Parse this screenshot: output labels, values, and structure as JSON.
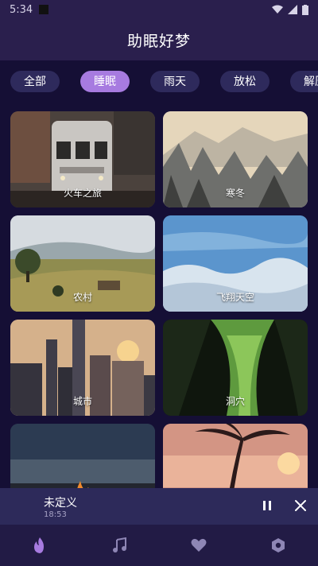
{
  "status_bar": {
    "time": "5:34"
  },
  "header": {
    "title": "助眠好梦"
  },
  "tabs": [
    {
      "label": "全部",
      "active": false
    },
    {
      "label": "睡眠",
      "active": true
    },
    {
      "label": "雨天",
      "active": false
    },
    {
      "label": "放松",
      "active": false
    },
    {
      "label": "解压",
      "active": false
    }
  ],
  "cards": [
    {
      "label": "火车之旅"
    },
    {
      "label": "寒冬"
    },
    {
      "label": "农村"
    },
    {
      "label": "飞翔天空"
    },
    {
      "label": "城市"
    },
    {
      "label": "洞穴"
    },
    {
      "label": ""
    },
    {
      "label": ""
    }
  ],
  "player": {
    "title": "未定义",
    "time": "18:53"
  },
  "bottom_nav": [
    "flame-icon",
    "music-icon",
    "heart-icon",
    "settings-icon"
  ],
  "colors": {
    "accent": "#a77be0",
    "background": "#150f35",
    "tab": "#2e2a5c"
  }
}
